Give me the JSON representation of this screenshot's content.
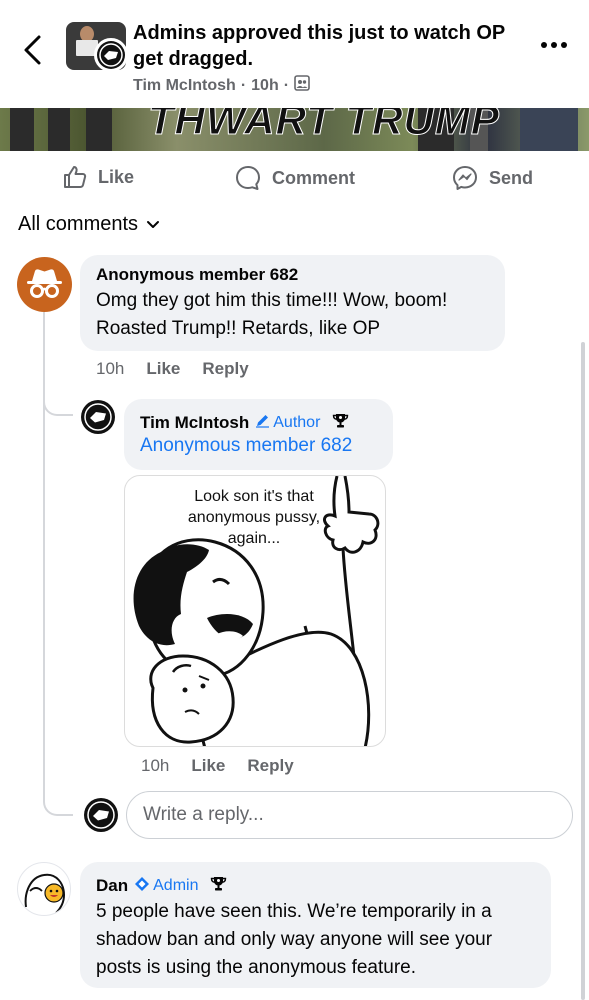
{
  "header": {
    "title": "Admins approved this just to watch OP get dragged.",
    "author": "Tim McIntosh",
    "time": "10h",
    "privacy_icon": "group-members-icon"
  },
  "photo": {
    "banner_text": "THWART TRUMP"
  },
  "actions": {
    "like": "Like",
    "comment": "Comment",
    "send": "Send"
  },
  "filter": {
    "label": "All comments"
  },
  "comments": [
    {
      "author": "Anonymous member 682",
      "text": "Omg they got him this time!!! Wow, boom! Roasted Trump!! Retards, like OP",
      "time": "10h",
      "like": "Like",
      "reply": "Reply",
      "avatar_color": "#c8641e"
    },
    {
      "author": "Tim McIntosh",
      "badge": "Author",
      "mention": "Anonymous member 682",
      "meme_caption": "Look son it's that anonymous pussy, again...",
      "time": "10h",
      "like": "Like",
      "reply": "Reply"
    },
    {
      "author": "Dan",
      "badge": "Admin",
      "text": "5 people have seen this. We’re temporarily in a shadow ban and only way anyone will see your posts is using the anonymous feature."
    }
  ],
  "reply_box": {
    "placeholder": "Write a reply..."
  },
  "colors": {
    "accent": "#1877f2",
    "secondary_text": "#65676b",
    "bubble": "#f0f2f5"
  }
}
